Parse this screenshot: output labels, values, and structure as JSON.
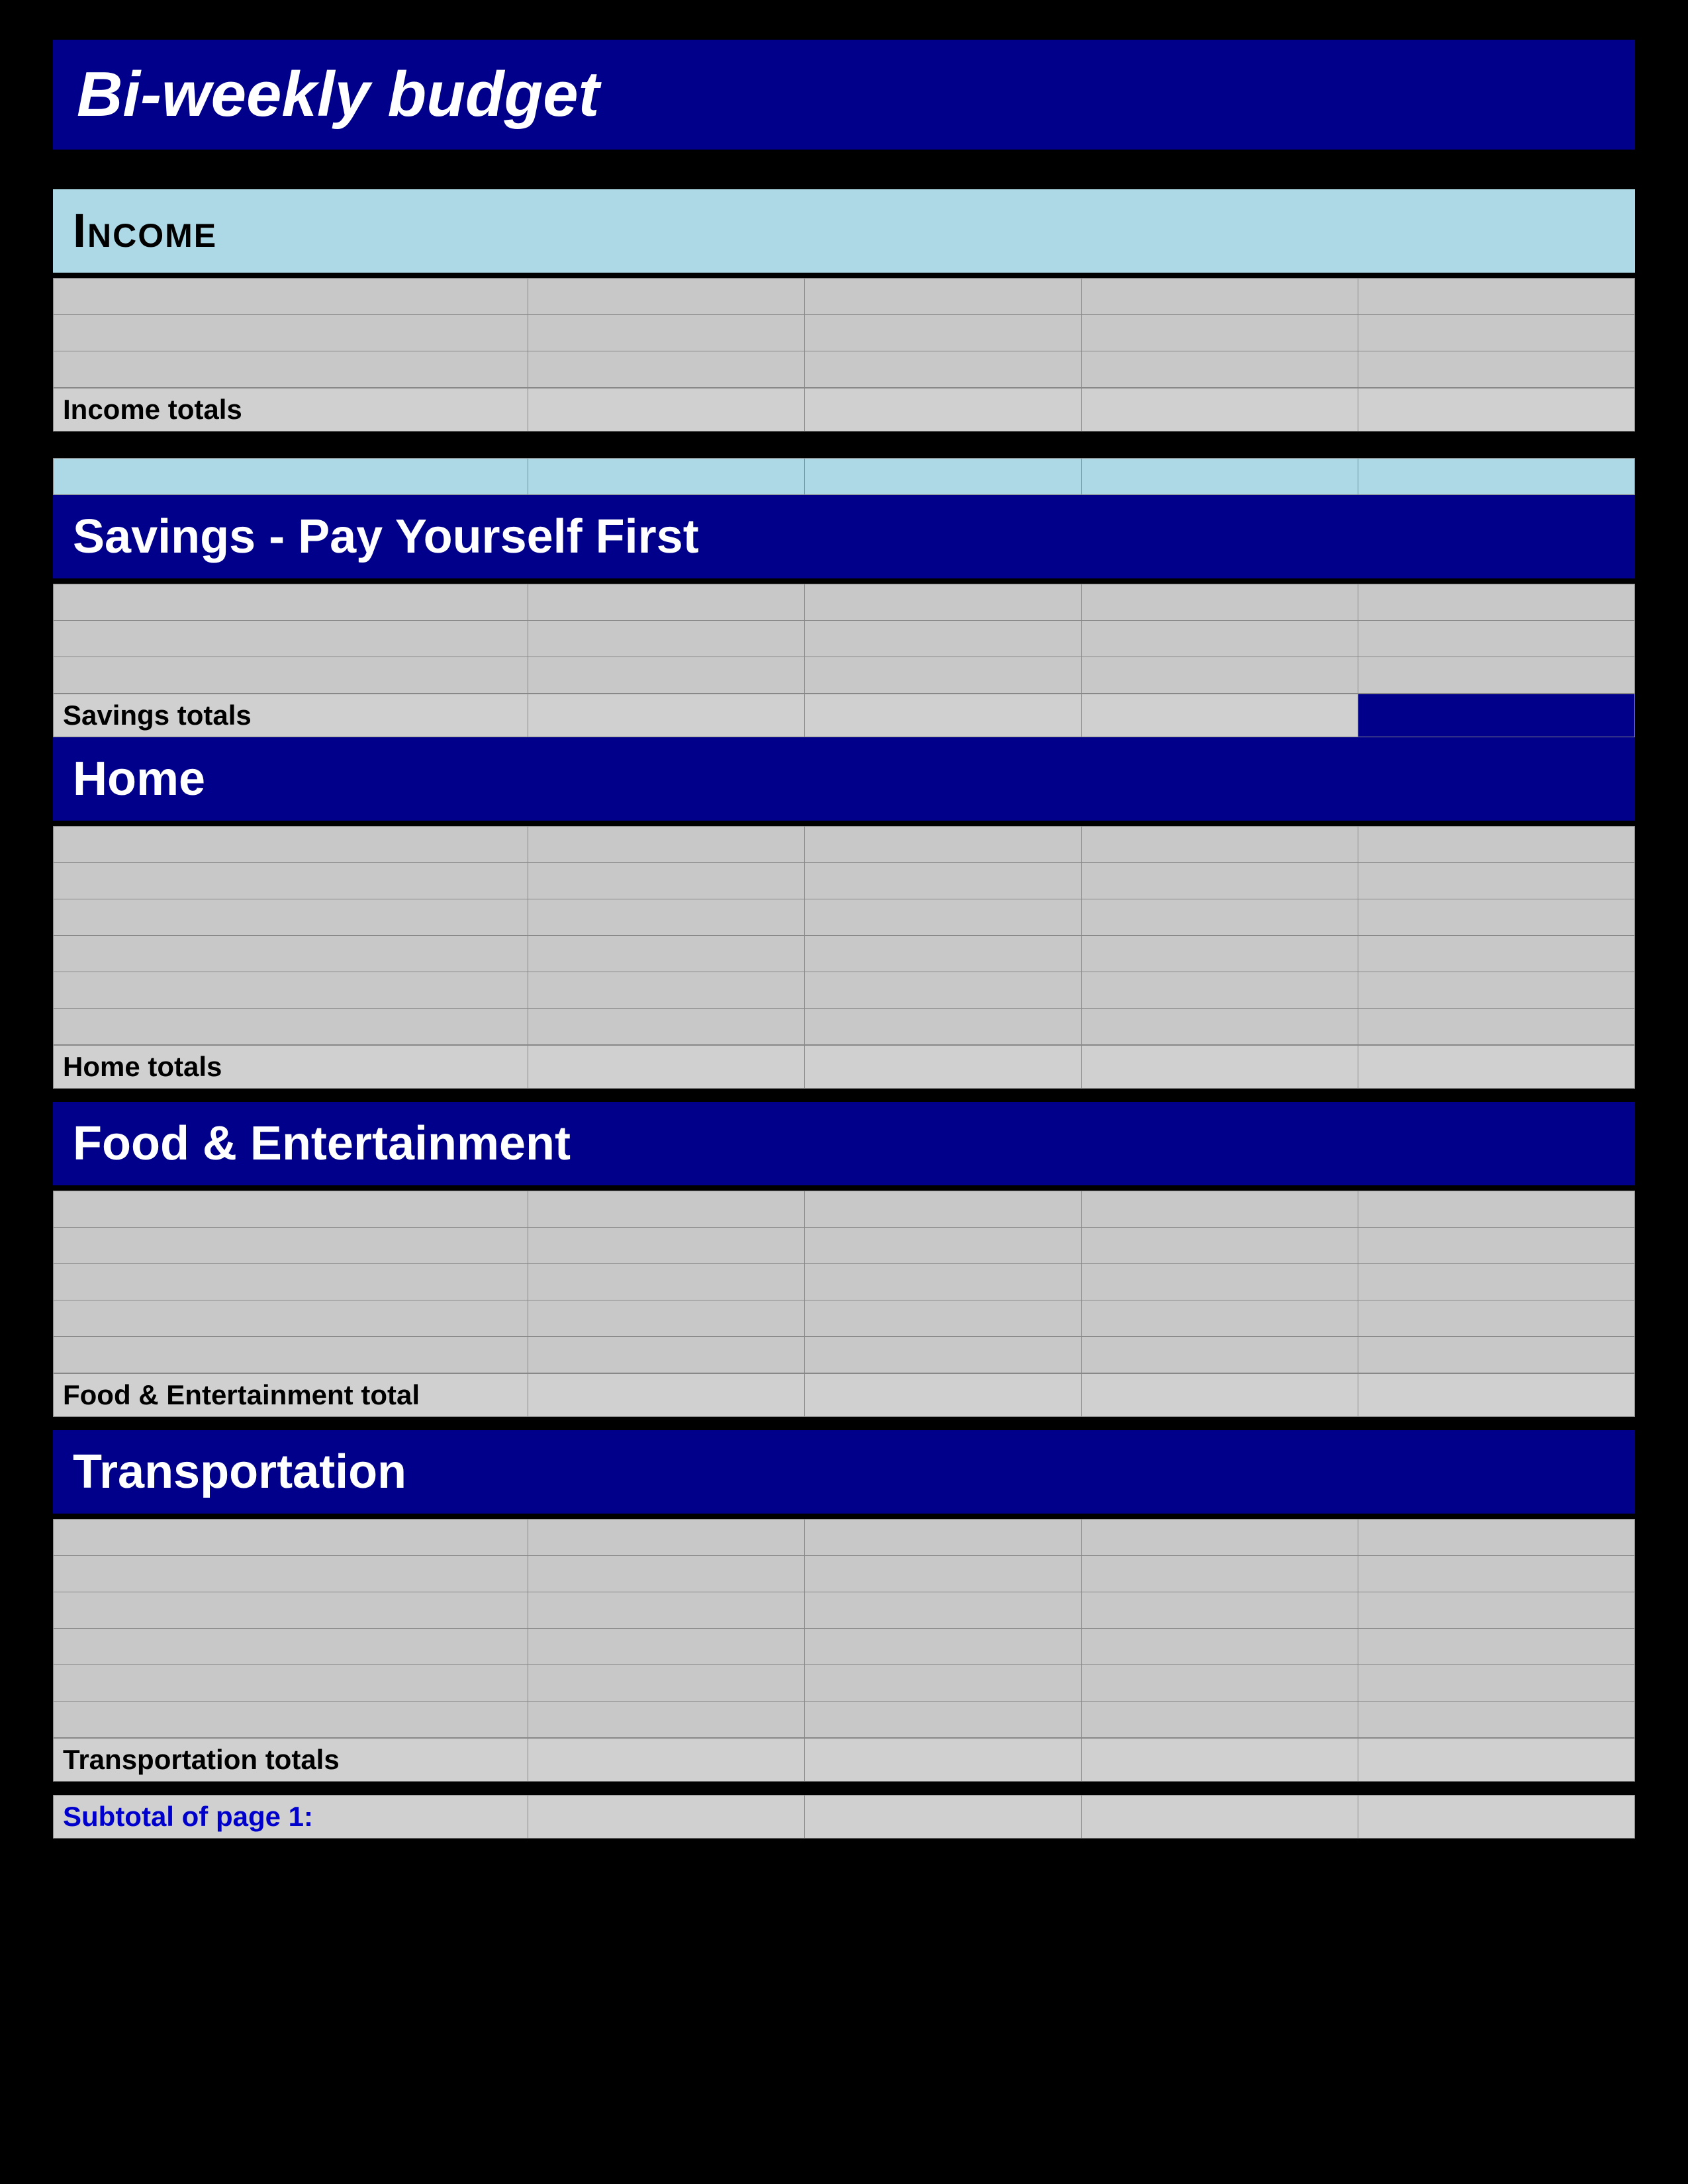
{
  "title": "Bi-weekly  budget",
  "sections": {
    "income": {
      "label": "Income",
      "totals_label": "Income totals"
    },
    "savings": {
      "label": "Savings - Pay Yourself First",
      "totals_label": "Savings totals"
    },
    "home": {
      "label": "Home",
      "totals_label": "Home totals"
    },
    "food": {
      "label": "Food & Entertainment",
      "totals_label": "Food & Entertainment total"
    },
    "transportation": {
      "label": "Transportation",
      "totals_label": "Transportation totals"
    },
    "subtotal": {
      "label": "Subtotal of page 1:"
    }
  }
}
